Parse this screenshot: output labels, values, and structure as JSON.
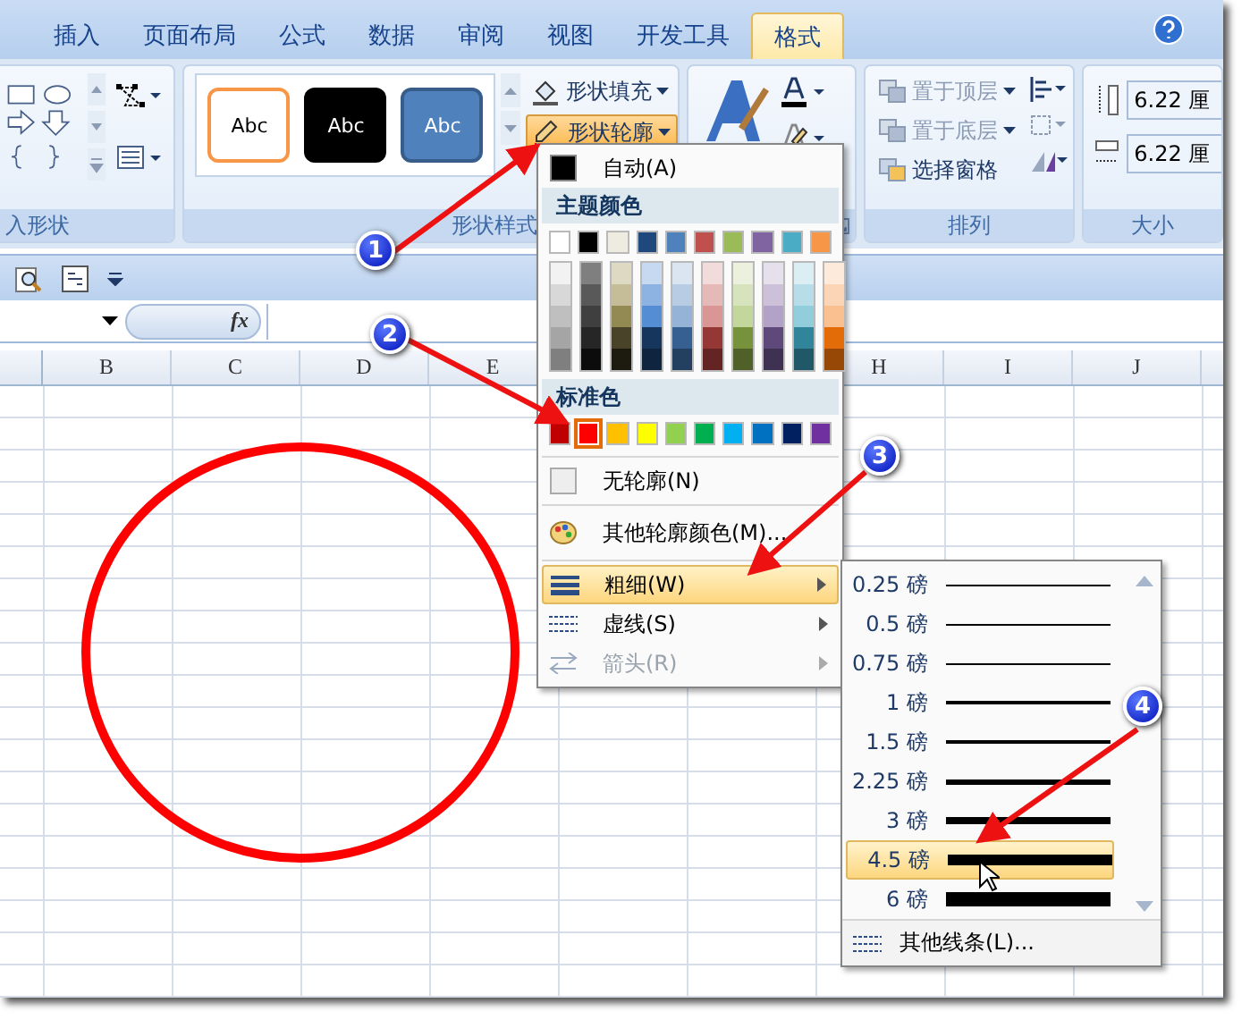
{
  "ribbon_tabs": [
    {
      "label": "插入",
      "selected": false
    },
    {
      "label": "页面布局",
      "selected": false
    },
    {
      "label": "公式",
      "selected": false
    },
    {
      "label": "数据",
      "selected": false
    },
    {
      "label": "审阅",
      "selected": false
    },
    {
      "label": "视图",
      "selected": false
    },
    {
      "label": "开发工具",
      "selected": false
    },
    {
      "label": "格式",
      "selected": true
    }
  ],
  "shapes_group": {
    "label": "入形状"
  },
  "shape_styles": {
    "label": "形状样式",
    "presets": [
      {
        "label": "Abc",
        "kind": "outline"
      },
      {
        "label": "Abc",
        "kind": "dark"
      },
      {
        "label": "Abc",
        "kind": "blue"
      }
    ],
    "fill_button": "形状填充",
    "outline_button": {
      "label": "形状轮廓",
      "highlighted": true
    }
  },
  "arrange": {
    "label": "排列",
    "buttons": [
      {
        "label": "置于顶层",
        "disabled": true
      },
      {
        "label": "置于底层",
        "disabled": true
      },
      {
        "label": "选择窗格",
        "disabled": false
      }
    ]
  },
  "size": {
    "label": "大小",
    "height": "6.22 厘",
    "width": "6.22 厘"
  },
  "formula_bar": {
    "function_label": "fx"
  },
  "column_headers_left": [
    {
      "label": "B"
    },
    {
      "label": "C"
    },
    {
      "label": "D"
    },
    {
      "label": "E"
    }
  ],
  "column_headers_right": [
    {
      "label": "H"
    },
    {
      "label": "I"
    },
    {
      "label": "J"
    }
  ],
  "outline_menu": {
    "automatic": "自动(A)",
    "theme_header": "主题颜色",
    "theme_colors": [
      {
        "color": "#ffffff",
        "shades": [
          {
            "color": "#f2f2f2"
          },
          {
            "color": "#d8d8d8"
          },
          {
            "color": "#bfbfbf"
          },
          {
            "color": "#a5a5a5"
          },
          {
            "color": "#7f7f7f"
          }
        ]
      },
      {
        "color": "#000000",
        "shades": [
          {
            "color": "#7f7f7f"
          },
          {
            "color": "#595959"
          },
          {
            "color": "#3f3f3f"
          },
          {
            "color": "#262626"
          },
          {
            "color": "#0c0c0c"
          }
        ]
      },
      {
        "color": "#eeece1",
        "shades": [
          {
            "color": "#ddd9c3"
          },
          {
            "color": "#c4bd97"
          },
          {
            "color": "#938953"
          },
          {
            "color": "#494429"
          },
          {
            "color": "#1d1b10"
          }
        ]
      },
      {
        "color": "#1f497d",
        "shades": [
          {
            "color": "#c6d9f0"
          },
          {
            "color": "#8db3e2"
          },
          {
            "color": "#548dd4"
          },
          {
            "color": "#17365d"
          },
          {
            "color": "#0f243e"
          }
        ]
      },
      {
        "color": "#4f81bd",
        "shades": [
          {
            "color": "#dbe5f1"
          },
          {
            "color": "#b8cce4"
          },
          {
            "color": "#95b3d7"
          },
          {
            "color": "#366092"
          },
          {
            "color": "#244061"
          }
        ]
      },
      {
        "color": "#c0504d",
        "shades": [
          {
            "color": "#f2dcdb"
          },
          {
            "color": "#e5b9b7"
          },
          {
            "color": "#d99694"
          },
          {
            "color": "#953734"
          },
          {
            "color": "#632423"
          }
        ]
      },
      {
        "color": "#9bbb59",
        "shades": [
          {
            "color": "#ebf1dd"
          },
          {
            "color": "#d7e3bc"
          },
          {
            "color": "#c3d69b"
          },
          {
            "color": "#76923c"
          },
          {
            "color": "#4f6128"
          }
        ]
      },
      {
        "color": "#8064a2",
        "shades": [
          {
            "color": "#e5e0ec"
          },
          {
            "color": "#ccc1d9"
          },
          {
            "color": "#b2a2c7"
          },
          {
            "color": "#5f497a"
          },
          {
            "color": "#3f3151"
          }
        ]
      },
      {
        "color": "#4bacc6",
        "shades": [
          {
            "color": "#dbeef3"
          },
          {
            "color": "#b7dde8"
          },
          {
            "color": "#92cddc"
          },
          {
            "color": "#31859b"
          },
          {
            "color": "#205867"
          }
        ]
      },
      {
        "color": "#f79646",
        "shades": [
          {
            "color": "#fdeada"
          },
          {
            "color": "#fbd5b5"
          },
          {
            "color": "#fac08f"
          },
          {
            "color": "#e36c09"
          },
          {
            "color": "#974806"
          }
        ]
      }
    ],
    "standard_header": "标准色",
    "standard_colors": [
      {
        "color": "#c00000",
        "selected": false
      },
      {
        "color": "#ff0000",
        "selected": true
      },
      {
        "color": "#ffc000",
        "selected": false
      },
      {
        "color": "#ffff00",
        "selected": false
      },
      {
        "color": "#92d050",
        "selected": false
      },
      {
        "color": "#00b050",
        "selected": false
      },
      {
        "color": "#00b0f0",
        "selected": false
      },
      {
        "color": "#0070c0",
        "selected": false
      },
      {
        "color": "#002060",
        "selected": false
      },
      {
        "color": "#7030a0",
        "selected": false
      }
    ],
    "items": [
      {
        "label": "无轮廓(N)",
        "kind": "none",
        "submenu": false,
        "highlighted": false,
        "disabled": false
      },
      {
        "label": "其他轮廓颜色(M)...",
        "kind": "palette",
        "submenu": false,
        "highlighted": false,
        "disabled": false
      },
      {
        "label": "粗细(W)",
        "kind": "weight",
        "submenu": true,
        "highlighted": true,
        "disabled": false
      },
      {
        "label": "虚线(S)",
        "kind": "dash",
        "submenu": true,
        "highlighted": false,
        "disabled": false
      },
      {
        "label": "箭头(R)",
        "kind": "arrow",
        "submenu": true,
        "highlighted": false,
        "disabled": true
      }
    ]
  },
  "weight_menu": {
    "items": [
      {
        "label": "0.25 磅",
        "selected": false
      },
      {
        "label": "0.5 磅",
        "selected": false
      },
      {
        "label": "0.75 磅",
        "selected": false
      },
      {
        "label": "1 磅",
        "selected": false
      },
      {
        "label": "1.5 磅",
        "selected": false
      },
      {
        "label": "2.25 磅",
        "selected": false
      },
      {
        "label": "3 磅",
        "selected": false
      },
      {
        "label": "4.5 磅",
        "selected": true
      },
      {
        "label": "6 磅",
        "selected": false
      }
    ],
    "more": "其他线条(L)..."
  },
  "callouts": [
    {
      "label": "1"
    },
    {
      "label": "2"
    },
    {
      "label": "3"
    },
    {
      "label": "4"
    }
  ]
}
